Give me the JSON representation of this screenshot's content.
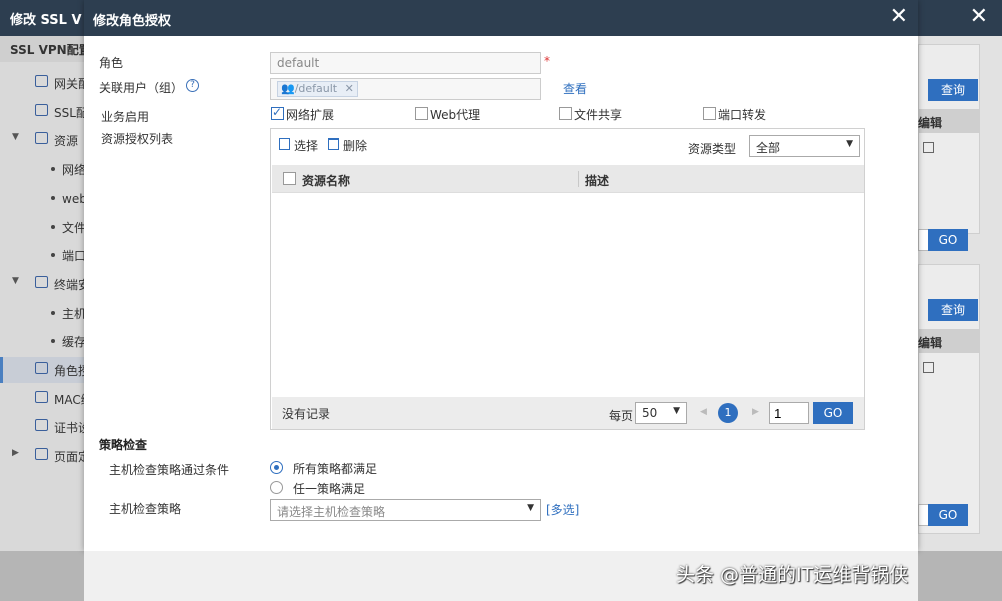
{
  "background": {
    "title": "修改 SSL V",
    "close": "✕",
    "sidebar": {
      "header": "SSL VPN配置",
      "items": [
        {
          "label": "网关配置",
          "kind": "item"
        },
        {
          "label": "SSL配置",
          "kind": "item"
        },
        {
          "label": "资源",
          "kind": "group"
        },
        {
          "label": "网络扩展",
          "kind": "sub"
        },
        {
          "label": "web代理",
          "kind": "sub"
        },
        {
          "label": "文件共享",
          "kind": "sub"
        },
        {
          "label": "端口转发",
          "kind": "sub"
        },
        {
          "label": "终端安全",
          "kind": "group"
        },
        {
          "label": "主机检查",
          "kind": "sub"
        },
        {
          "label": "缓存清除",
          "kind": "sub"
        },
        {
          "label": "角色授权",
          "kind": "item",
          "active": true
        },
        {
          "label": "MAC绑定",
          "kind": "item"
        },
        {
          "label": "证书设置",
          "kind": "item"
        },
        {
          "label": "页面定制",
          "kind": "group-collapsed"
        }
      ]
    },
    "right": {
      "query_label": "查询",
      "edit_header": "编辑",
      "go_label": "GO"
    }
  },
  "modal": {
    "title": "修改角色授权",
    "close": "✕",
    "role": {
      "label": "角色",
      "value": "default",
      "required_mark": "*"
    },
    "user": {
      "label": "关联用户（组）",
      "help": "?",
      "tag": "/default",
      "tag_remove": "✕",
      "view_link": "查看"
    },
    "services": {
      "label": "业务启用",
      "options": [
        {
          "label": "网络扩展",
          "checked": true
        },
        {
          "label": "Web代理",
          "checked": false
        },
        {
          "label": "文件共享",
          "checked": false
        },
        {
          "label": "端口转发",
          "checked": false
        }
      ]
    },
    "resources": {
      "label": "资源授权列表",
      "select_label": "选择",
      "delete_label": "删除",
      "type_label": "资源类型",
      "type_value": "全部",
      "columns": [
        "资源名称",
        "描述"
      ],
      "empty_text": "没有记录",
      "per_page_label": "每页",
      "per_page_value": "50",
      "current_page": "1",
      "page_input": "1",
      "go_label": "GO"
    },
    "policy": {
      "section_title": "策略检查",
      "condition_label": "主机检查策略通过条件",
      "condition_options": [
        {
          "label": "所有策略都满足",
          "checked": true
        },
        {
          "label": "任一策略满足",
          "checked": false
        }
      ],
      "policy_label": "主机检查策略",
      "policy_placeholder": "请选择主机检查策略",
      "multi_select": "[多选]"
    }
  },
  "watermark": "头条 @普通的IT运维背锅侠"
}
